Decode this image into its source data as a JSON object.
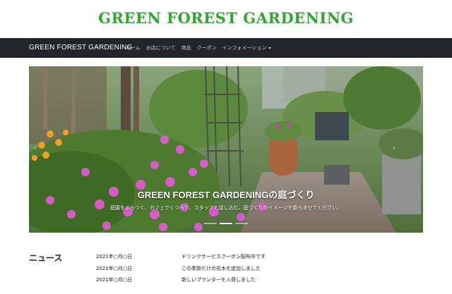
{
  "header": {
    "logo": "GREEN FOREST GARDENING"
  },
  "navbar": {
    "brand": "GREEN FOREST GARDENING",
    "links": [
      {
        "label": "ホーム"
      },
      {
        "label": "お店について"
      },
      {
        "label": "商品"
      },
      {
        "label": "クーポン"
      },
      {
        "label": "インフォメーション",
        "dropdown": true
      }
    ]
  },
  "carousel": {
    "title": "GREEN FOREST GARDENINGの庭づくり",
    "text": "庭園をぶらつく、カフェでくつろぐ、スタッフと話し込む、庭づくりのイメージを膨らませてください。",
    "slides": 3,
    "active_slide": 1
  },
  "news": {
    "heading": "ニュース",
    "items": [
      {
        "date": "2021年○月○日",
        "title": "ドリンクサービスクーポン配布中です"
      },
      {
        "date": "2021年○月○日",
        "title": "この季節だけの花木を追加しました"
      },
      {
        "date": "2021年○月○日",
        "title": "新しいプランターを入荷しました"
      }
    ]
  },
  "colors": {
    "brand_green": "#2ea82e",
    "navbar_bg": "#212529",
    "nav_text": "#c6c8ca"
  }
}
